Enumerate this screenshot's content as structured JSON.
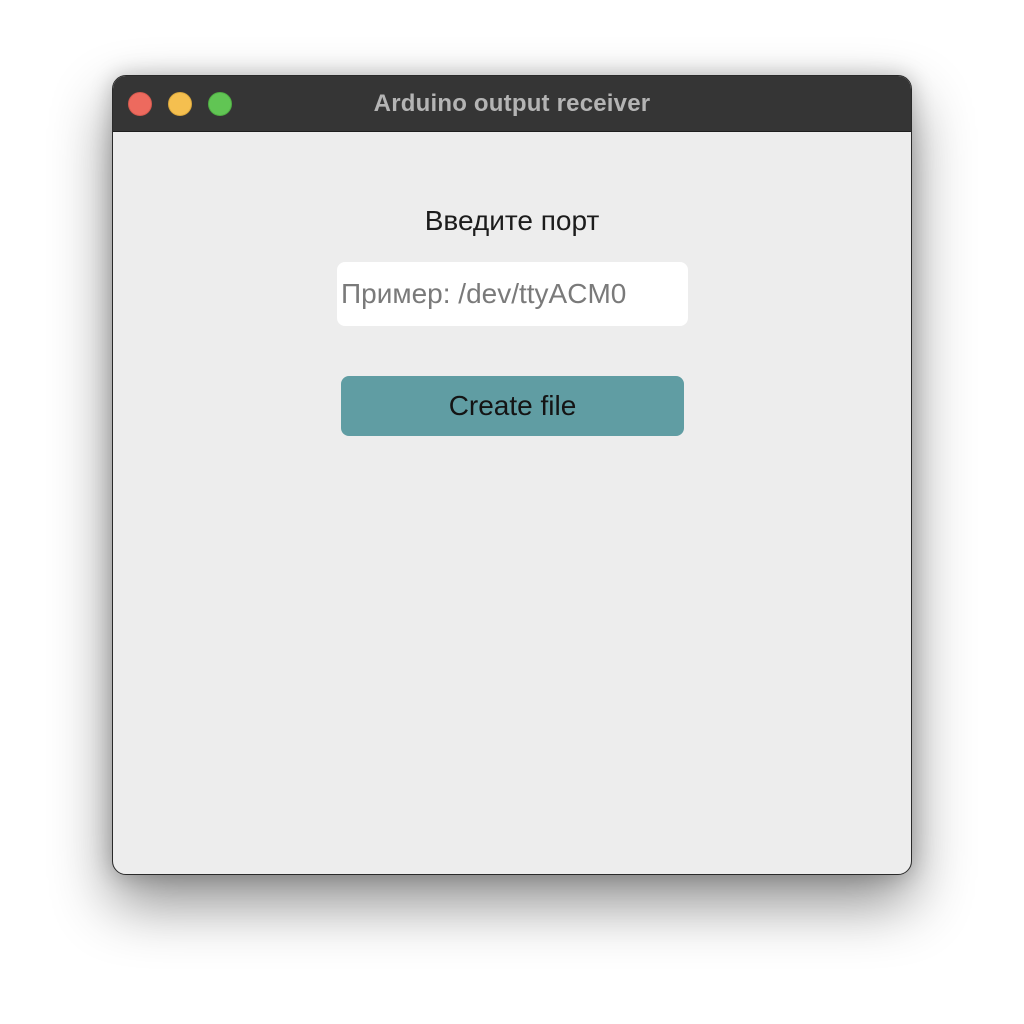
{
  "window": {
    "title": "Arduino output receiver"
  },
  "form": {
    "port_label": "Введите порт",
    "port_input": {
      "value": "",
      "placeholder": "Пример: /dev/ttyACM0"
    },
    "create_button_label": "Create file"
  },
  "colors": {
    "titlebar": "#353535",
    "window_background": "#ededed",
    "button_background": "#609da3",
    "traffic_close": "#ed6a5e",
    "traffic_minimize": "#f5bf4f",
    "traffic_zoom": "#61c554"
  }
}
